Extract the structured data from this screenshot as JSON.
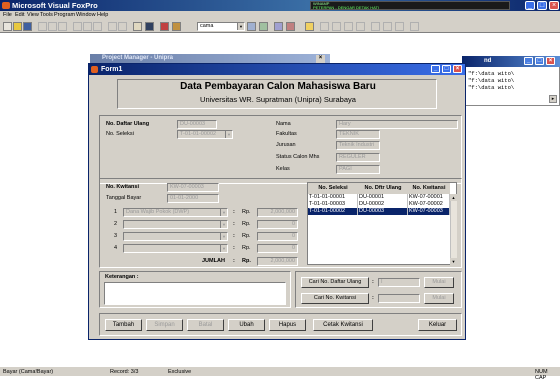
{
  "app": {
    "title": "Microsoft Visual FoxPro",
    "winamp_line1": "WINAMP",
    "winamp_line2": "PETERPAN - DENGAR DETAK HATI"
  },
  "menu": [
    "File",
    "Edit",
    "View",
    "Tools",
    "Program",
    "Window",
    "Help"
  ],
  "toolbar": {
    "combo_value": "cama"
  },
  "command_window": {
    "title": "nd",
    "lines": [
      "\"f:\\data wito\\",
      "\"f:\\data wito\\",
      "\"f:\\data wito\\"
    ]
  },
  "project_manager": {
    "title": "Project Manager - Unipra"
  },
  "form": {
    "title": "Form1",
    "heading": "Data Pembayaran Calon Mahasiswa Baru",
    "subheading": "Universitas WR. Supratman (Unipra) Surabaya",
    "labels": {
      "no_daftar": "No. Daftar Ulang",
      "no_seleksi": "No. Seleksi",
      "nama": "Nama",
      "fakultas": "Fakultas",
      "jurusan": "Jurusan",
      "status": "Status Calon Mhs",
      "kelas": "Kelas",
      "no_kwitansi": "No. Kwitansi",
      "tanggal": "Tanggal Bayar",
      "jumlah": "JUMLAH",
      "keterangan": "Keterangan :",
      "rp": "Rp.",
      "colon": ":"
    },
    "values": {
      "no_daftar": "DU-00003",
      "no_seleksi": "T-01-01-00002",
      "nama": "Hary",
      "fakultas": "TEKNIK",
      "jurusan": "Teknik Industri",
      "status": "REGULER",
      "kelas": "PAGI",
      "no_kwitansi": "KW-07-00003",
      "tanggal": "01-01-2000",
      "jumlah": "2,000,000"
    },
    "payments": [
      {
        "no": "1",
        "item": "Dana Wajib Pokok (DWP)",
        "amount": "2,000,000"
      },
      {
        "no": "2",
        "item": "",
        "amount": "0"
      },
      {
        "no": "3",
        "item": "",
        "amount": "0"
      },
      {
        "no": "4",
        "item": "",
        "amount": "0"
      }
    ],
    "grid": {
      "headers": [
        "No. Seleksi",
        "No. Dftr Ulang",
        "No. Kwitansi"
      ],
      "rows": [
        [
          "T-01-01-00001",
          "DU-00001",
          "KW-07-00001"
        ],
        [
          "T-01-01-00003",
          "DU-00002",
          "KW-07-00002"
        ],
        [
          "T-01-01-00002",
          "DU-00003",
          "KW-07-00003"
        ]
      ]
    },
    "search": {
      "by_daftar": "Cari No. Daftar Ulang",
      "by_kwitansi": "Cari No. Kwitansi",
      "input_value": "I",
      "go_label": "Mulai"
    },
    "buttons": {
      "tambah": "Tambah",
      "simpan": "Simpan",
      "batal": "Batal",
      "ubah": "Ubah",
      "hapus": "Hapus",
      "cetak": "Cetak Kwitansi",
      "keluar": "Keluar"
    }
  },
  "status": {
    "table": "Bayar (Cama!Bayar)",
    "record": "Record: 3/3",
    "mode": "Exclusive",
    "keys": "NUM CAP"
  }
}
